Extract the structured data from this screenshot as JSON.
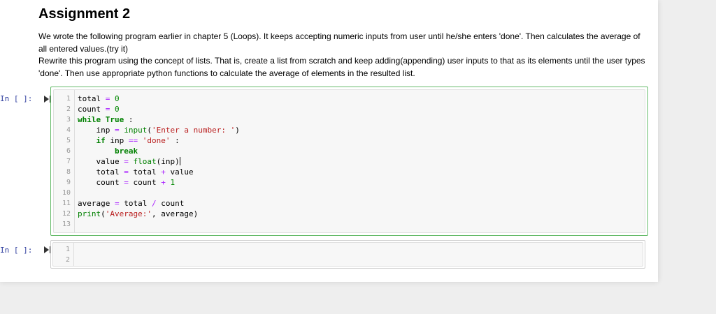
{
  "markdown": {
    "title": "Assignment 2",
    "paragraph1": "We wrote the following program earlier in chapter 5 (Loops). It keeps accepting numeric inputs from user until he/she enters 'done'. Then calculates the average of all entered values.(try it)",
    "paragraph2": "Rewrite this program using the concept of lists. That is, create a list from scratch and keep adding(appending) user inputs to that as its elements until the user types 'done'. Then use appropriate python functions to calculate the average of elements in the resulted list."
  },
  "cells": [
    {
      "prompt": "In [ ]:",
      "line_numbers": [
        "1",
        "2",
        "3",
        "4",
        "5",
        "6",
        "7",
        "8",
        "9",
        "10",
        "11",
        "12",
        "13"
      ],
      "code_lines": [
        [
          {
            "t": "total ",
            "c": ""
          },
          {
            "t": "=",
            "c": "op"
          },
          {
            "t": " ",
            "c": ""
          },
          {
            "t": "0",
            "c": "num"
          }
        ],
        [
          {
            "t": "count ",
            "c": ""
          },
          {
            "t": "=",
            "c": "op"
          },
          {
            "t": " ",
            "c": ""
          },
          {
            "t": "0",
            "c": "num"
          }
        ],
        [
          {
            "t": "while",
            "c": "kw"
          },
          {
            "t": " ",
            "c": ""
          },
          {
            "t": "True",
            "c": "kw"
          },
          {
            "t": " :",
            "c": ""
          }
        ],
        [
          {
            "t": "    inp ",
            "c": ""
          },
          {
            "t": "=",
            "c": "op"
          },
          {
            "t": " ",
            "c": ""
          },
          {
            "t": "input",
            "c": "bi"
          },
          {
            "t": "(",
            "c": ""
          },
          {
            "t": "'Enter a number: '",
            "c": "str"
          },
          {
            "t": ")",
            "c": ""
          }
        ],
        [
          {
            "t": "    ",
            "c": ""
          },
          {
            "t": "if",
            "c": "kw"
          },
          {
            "t": " inp ",
            "c": ""
          },
          {
            "t": "==",
            "c": "op"
          },
          {
            "t": " ",
            "c": ""
          },
          {
            "t": "'done'",
            "c": "str"
          },
          {
            "t": " :",
            "c": ""
          }
        ],
        [
          {
            "t": "        ",
            "c": ""
          },
          {
            "t": "break",
            "c": "kw"
          }
        ],
        [
          {
            "t": "    value ",
            "c": ""
          },
          {
            "t": "=",
            "c": "op"
          },
          {
            "t": " ",
            "c": ""
          },
          {
            "t": "float",
            "c": "bi"
          },
          {
            "t": "(inp)",
            "c": ""
          }
        ],
        [
          {
            "t": "    total ",
            "c": ""
          },
          {
            "t": "=",
            "c": "op"
          },
          {
            "t": " total ",
            "c": ""
          },
          {
            "t": "+",
            "c": "op"
          },
          {
            "t": " value",
            "c": ""
          }
        ],
        [
          {
            "t": "    count ",
            "c": ""
          },
          {
            "t": "=",
            "c": "op"
          },
          {
            "t": " count ",
            "c": ""
          },
          {
            "t": "+",
            "c": "op"
          },
          {
            "t": " ",
            "c": ""
          },
          {
            "t": "1",
            "c": "num"
          }
        ],
        [],
        [
          {
            "t": "average ",
            "c": ""
          },
          {
            "t": "=",
            "c": "op"
          },
          {
            "t": " total ",
            "c": ""
          },
          {
            "t": "/",
            "c": "op"
          },
          {
            "t": " count",
            "c": ""
          }
        ],
        [
          {
            "t": "print",
            "c": "bi"
          },
          {
            "t": "(",
            "c": ""
          },
          {
            "t": "'Average:'",
            "c": "str"
          },
          {
            "t": ", average)",
            "c": ""
          }
        ],
        []
      ]
    },
    {
      "prompt": "In [ ]:",
      "line_numbers": [
        "1",
        "2"
      ],
      "code_lines": [
        [],
        []
      ]
    }
  ]
}
